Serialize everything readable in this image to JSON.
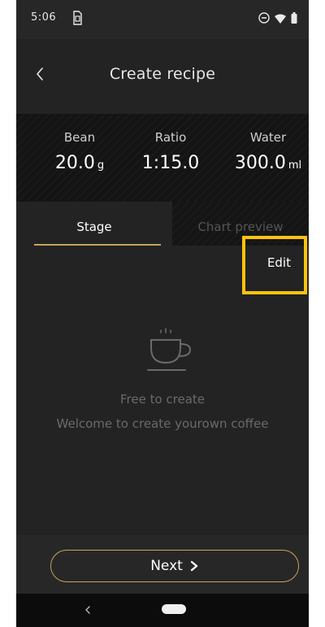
{
  "status_bar": {
    "time": "5:06",
    "icons": [
      "sim-icon",
      "do-not-disturb-icon",
      "wifi-icon",
      "battery-icon"
    ]
  },
  "header": {
    "title": "Create recipe",
    "back_icon": "chevron-left-icon"
  },
  "summary": {
    "bean": {
      "label": "Bean",
      "value": "20.0",
      "unit": "g"
    },
    "ratio": {
      "label": "Ratio",
      "value": "1:15.0"
    },
    "water": {
      "label": "Water",
      "value": "300.0",
      "unit": "ml"
    }
  },
  "tabs": [
    {
      "label": "Stage",
      "active": true
    },
    {
      "label": "Chart preview",
      "active": false
    }
  ],
  "content": {
    "edit_label": "Edit",
    "empty_icon": "coffee-cup-icon",
    "empty_title": "Free to create",
    "empty_subtitle": "Welcome to create yourown coffee"
  },
  "footer": {
    "next_label": "Next",
    "next_icon": "chevron-right-icon"
  },
  "colors": {
    "accent_gold": "#c8a45a",
    "highlight_yellow": "#ffc20e",
    "background": "#232323"
  }
}
